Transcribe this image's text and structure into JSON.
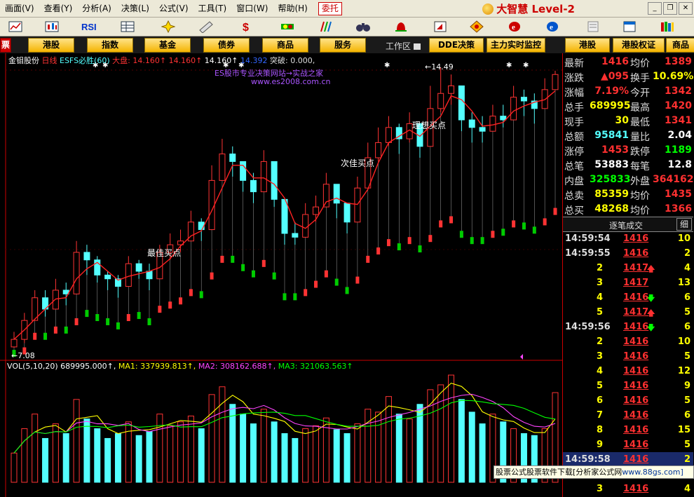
{
  "menu": {
    "items": [
      "画面(V)",
      "查看(Y)",
      "分析(A)",
      "决策(L)",
      "公式(V)",
      "工具(T)",
      "窗口(W)",
      "帮助(H)"
    ],
    "entrust": "委托",
    "brand": "大智慧 Level-2"
  },
  "tabs": [
    "港股",
    "指数",
    "基金",
    "债券",
    "商品",
    "服务"
  ],
  "tabs_right": [
    "DDE决策",
    "主力实时监控",
    "港股",
    "港股权证",
    "商品"
  ],
  "workarea": "工作区",
  "chart": {
    "title_stock": "金钼股份",
    "title_period": "日线",
    "title_indicator": "ESFS必胜(60)",
    "title_market": "大盘:",
    "title_values": [
      "14.160↑",
      "14.160↑",
      "14.160↑",
      "14.392"
    ],
    "title_break": "突破: 0.000,",
    "site_line1": "ES股市专业决策网站→实战之家",
    "site_line2": "www.es2008.com.cn",
    "label_best": "最佳买点",
    "label_second": "次佳买点",
    "label_ideal": "理想买点",
    "high_marker": "←14.49",
    "low_marker": "←7.08",
    "vol_title": "VOL(5,10,20) 689995.000↑,",
    "ma1": "MA1: 337939.813↑,",
    "ma2": "MA2: 308162.688↑,",
    "ma3": "MA3: 321063.563↑",
    "colors": {
      "up": "#ff3333",
      "down": "#54ffff",
      "green": "#00cc00",
      "ma1": "#ffff00",
      "ma2": "#ff44ff",
      "ma3": "#00ff00"
    }
  },
  "chart_data": {
    "type": "candlestick",
    "price_range": [
      7.08,
      14.49
    ],
    "closes": [
      7.3,
      7.8,
      8.4,
      8.1,
      8.6,
      8.5,
      9.6,
      9.4,
      9.0,
      8.9,
      8.7,
      9.3,
      9.1,
      8.9,
      9.6,
      9.8,
      9.9,
      10.4,
      10.2,
      11.5,
      12.2,
      12.0,
      11.5,
      11.2,
      12.0,
      11.0,
      10.1,
      10.0,
      10.6,
      10.8,
      11.4,
      10.9,
      10.4,
      11.3,
      12.1,
      12.5,
      12.9,
      12.6,
      13.0,
      12.4,
      13.4,
      13.8,
      14.0,
      13.1,
      12.9,
      12.8,
      13.2,
      13.1,
      13.7,
      13.6,
      13.4,
      13.9,
      14.3
    ],
    "highs": [
      7.5,
      8.0,
      8.6,
      8.6,
      8.9,
      8.8,
      9.9,
      9.8,
      9.5,
      9.1,
      9.0,
      9.5,
      9.4,
      9.3,
      9.8,
      10.1,
      10.2,
      10.7,
      10.5,
      11.9,
      12.6,
      12.4,
      12.0,
      11.7,
      12.3,
      11.6,
      10.6,
      10.4,
      10.9,
      11.1,
      11.7,
      11.2,
      10.8,
      11.6,
      12.5,
      12.9,
      13.2,
      13.0,
      13.3,
      12.9,
      14.0,
      14.49,
      14.3,
      13.7,
      13.3,
      13.2,
      13.5,
      13.5,
      14.0,
      13.9,
      13.8,
      14.2,
      14.4
    ],
    "lows": [
      7.08,
      7.2,
      7.9,
      7.9,
      8.2,
      8.2,
      8.6,
      9.0,
      8.8,
      8.6,
      8.4,
      8.8,
      8.9,
      8.6,
      9.2,
      9.4,
      9.6,
      10.0,
      9.9,
      10.8,
      11.6,
      11.6,
      11.2,
      10.9,
      11.4,
      10.8,
      9.8,
      9.8,
      10.0,
      10.4,
      10.9,
      10.5,
      10.1,
      10.6,
      11.6,
      12.0,
      12.4,
      12.2,
      12.5,
      12.1,
      12.6,
      13.3,
      13.5,
      12.8,
      12.5,
      12.5,
      12.8,
      12.9,
      13.3,
      13.2,
      13.0,
      13.4,
      13.9
    ],
    "volumes": [
      30,
      55,
      70,
      45,
      60,
      50,
      85,
      65,
      55,
      45,
      50,
      62,
      48,
      52,
      70,
      58,
      62,
      68,
      55,
      90,
      98,
      80,
      70,
      60,
      75,
      62,
      50,
      45,
      55,
      58,
      66,
      54,
      50,
      60,
      75,
      72,
      88,
      70,
      65,
      80,
      95,
      100,
      110,
      85,
      72,
      60,
      70,
      62,
      55,
      50,
      48,
      55,
      92
    ]
  },
  "quote": {
    "rows": [
      {
        "l1": "最新",
        "v1": "1416",
        "l2": "均价",
        "v2": "1389",
        "c1": "#ff3030",
        "c2": "#ff3030"
      },
      {
        "l1": "涨跌",
        "v1": "▲095",
        "l2": "换手",
        "v2": "10.69%",
        "c1": "#ff3030",
        "c2": "#ffff00"
      },
      {
        "l1": "涨幅",
        "v1": "7.19%",
        "l2": "今开",
        "v2": "1342",
        "c1": "#ff3030",
        "c2": "#ff3030"
      },
      {
        "l1": "总手",
        "v1": "689995",
        "l2": "最高",
        "v2": "1420",
        "c1": "#ffff00",
        "c2": "#ff3030"
      },
      {
        "l1": "现手",
        "v1": "30",
        "l2": "最低",
        "v2": "1341",
        "c1": "#ffff00",
        "c2": "#ff3030"
      },
      {
        "l1": "总额",
        "v1": "95841",
        "l2": "量比",
        "v2": "2.04",
        "c1": "#54ffff",
        "c2": "#ffffff"
      },
      {
        "l1": "涨停",
        "v1": "1453",
        "l2": "跌停",
        "v2": "1189",
        "c1": "#ff3030",
        "c2": "#00ff00"
      },
      {
        "l1": "总笔",
        "v1": "53883",
        "l2": "每笔",
        "v2": "12.8",
        "c1": "#ffffff",
        "c2": "#ffffff"
      },
      {
        "l1": "内盘",
        "v1": "325833",
        "l2": "外盘",
        "v2": "364162",
        "c1": "#00ff00",
        "c2": "#ff3030"
      },
      {
        "l1": "总卖",
        "v1": "85359",
        "l2": "均价",
        "v2": "1435",
        "c1": "#ffff00",
        "c2": "#ff3030"
      },
      {
        "l1": "总买",
        "v1": "48268",
        "l2": "均价",
        "v2": "1366",
        "c1": "#ffff00",
        "c2": "#ff3030"
      }
    ],
    "tick_title": "逐笔成交",
    "tick_detail": "细",
    "ticks": [
      {
        "t": "14:59:54",
        "p": "1416",
        "a": "",
        "v": "10"
      },
      {
        "t": "14:59:55",
        "p": "1416",
        "a": "",
        "v": "2"
      },
      {
        "t": "2",
        "p": "1417",
        "a": "up",
        "v": "4"
      },
      {
        "t": "3",
        "p": "1417",
        "a": "",
        "v": "13"
      },
      {
        "t": "4",
        "p": "1416",
        "a": "down",
        "v": "6"
      },
      {
        "t": "5",
        "p": "1417",
        "a": "up",
        "v": "5"
      },
      {
        "t": "14:59:56",
        "p": "1416",
        "a": "down",
        "v": "6"
      },
      {
        "t": "2",
        "p": "1416",
        "a": "",
        "v": "10"
      },
      {
        "t": "3",
        "p": "1416",
        "a": "",
        "v": "5"
      },
      {
        "t": "4",
        "p": "1416",
        "a": "",
        "v": "12"
      },
      {
        "t": "5",
        "p": "1416",
        "a": "",
        "v": "9"
      },
      {
        "t": "6",
        "p": "1416",
        "a": "",
        "v": "5"
      },
      {
        "t": "7",
        "p": "1416",
        "a": "",
        "v": "6"
      },
      {
        "t": "8",
        "p": "1416",
        "a": "",
        "v": "15"
      },
      {
        "t": "9",
        "p": "1416",
        "a": "",
        "v": "5"
      },
      {
        "t": "14:59:58",
        "p": "1416",
        "a": "",
        "v": "2"
      },
      {
        "t": "",
        "p": "",
        "a": "",
        "v": ""
      },
      {
        "t": "3",
        "p": "1416",
        "a": "",
        "v": "4"
      }
    ]
  },
  "ad": {
    "text": "股票公式股票软件下载[分析家公式网",
    "url": "www.88gs.com]"
  }
}
